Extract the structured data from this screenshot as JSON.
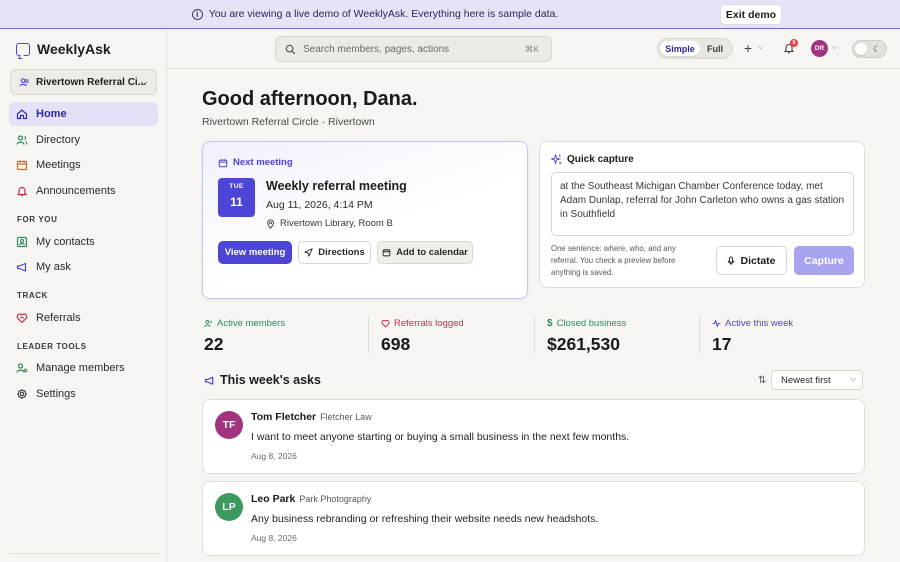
{
  "banner": {
    "text": "You are viewing a live demo of WeeklyAsk. Everything here is sample data.",
    "exit_label": "Exit demo"
  },
  "brand": {
    "name": "WeeklyAsk"
  },
  "org": {
    "name": "Rivertown Referral Ci..."
  },
  "nav": {
    "home": "Home",
    "directory": "Directory",
    "meetings": "Meetings",
    "announcements": "Announcements",
    "for_you": "FOR YOU",
    "my_contacts": "My contacts",
    "my_ask": "My ask",
    "track": "TRACK",
    "referrals": "Referrals",
    "leader_tools": "LEADER TOOLS",
    "manage_members": "Manage members",
    "settings": "Settings"
  },
  "topbar": {
    "search_placeholder": "Search members, pages, actions",
    "search_shortcut": "⌘K",
    "mode_simple": "Simple",
    "mode_full": "Full",
    "notification_count": "6",
    "user_initials": "DR"
  },
  "greeting": {
    "title": "Good afternoon, Dana.",
    "subtitle": "Rivertown Referral Circle · Rivertown"
  },
  "next_meeting": {
    "label": "Next meeting",
    "dow": "TUE",
    "day": "11",
    "title": "Weekly referral meeting",
    "when": "Aug 11, 2026, 4:14 PM",
    "where": "Rivertown Library, Room B",
    "view_label": "View meeting",
    "directions_label": "Directions",
    "calendar_label": "Add to calendar"
  },
  "quick_capture": {
    "label": "Quick capture",
    "text": "at the Southeast Michigan Chamber Conference today, met Adam Dunlap, referral for John Carleton who owns a gas station in Southfield",
    "hint": "One sentence: where, who, and any referral. You check a preview before anything is saved.",
    "dictate_label": "Dictate",
    "capture_label": "Capture"
  },
  "stats": [
    {
      "label": "Active members",
      "value": "22",
      "color": "#2f8a5a"
    },
    {
      "label": "Referrals logged",
      "value": "698",
      "color": "#c2304d"
    },
    {
      "label": "Closed business",
      "value": "$261,530",
      "color": "#2f8a5a"
    },
    {
      "label": "Active this week",
      "value": "17",
      "color": "#4d45d6"
    }
  ],
  "asks": {
    "title": "This week's asks",
    "sort_value": "Newest first",
    "items": [
      {
        "initials": "TF",
        "name": "Tom Fletcher",
        "company": "Fletcher Law",
        "message": "I want to meet anyone starting or buying a small business in the next few months.",
        "date": "Aug 8, 2026",
        "color": "#a3337f"
      },
      {
        "initials": "LP",
        "name": "Leo Park",
        "company": "Park Photography",
        "message": "Any business rebranding or refreshing their website needs new headshots.",
        "date": "Aug 8, 2026",
        "color": "#3c9a5f"
      }
    ]
  }
}
